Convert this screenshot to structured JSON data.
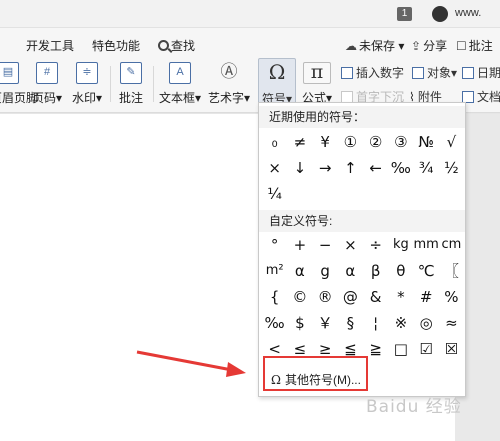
{
  "topbar": {
    "badge": "1",
    "username": "www."
  },
  "tabs": {
    "dev_tools": "开发工具",
    "special": "特色功能",
    "search": "查找"
  },
  "tools": {
    "unsaved": "未保存",
    "share": "分享",
    "comment": "批注"
  },
  "ribbon": {
    "header_footer": "页眉页脚",
    "page_number": "页码",
    "watermark": "水印",
    "comment": "批注",
    "textbox": "文本框",
    "wordart": "艺术字",
    "symbol": "符号",
    "formula": "公式",
    "insert_number": "插入数字",
    "object": "对象",
    "date": "日期",
    "drop_cap": "首字下沉",
    "attachment": "附件",
    "document": "文档"
  },
  "symbol_menu": {
    "recent_title": "近期使用的符号：",
    "recent": [
      "₀",
      "≠",
      "¥",
      "①",
      "②",
      "③",
      "№",
      "√",
      "×",
      "↓",
      "→",
      "↑",
      "←",
      "‰",
      "¾",
      "½",
      "¼"
    ],
    "custom_title": "自定义符号:",
    "custom": [
      "°",
      "+",
      "−",
      "×",
      "÷",
      "kg",
      "mm",
      "cm",
      "m²",
      "α",
      "g",
      "α",
      "β",
      "θ",
      "℃",
      "〖",
      "{",
      "©",
      "®",
      "@",
      "&",
      "*",
      "#",
      "%",
      "‰",
      "$",
      "￥",
      "§",
      "¦",
      "※",
      "◎",
      "≈",
      "<",
      "≤",
      "≥",
      "≦",
      "≧",
      "□",
      "☑",
      "☒"
    ],
    "more_symbols": "其他符号(M)..."
  },
  "watermark_text": "Baidu 经验",
  "colors": {
    "highlight": "#e53935",
    "accent": "#4a6fa5"
  }
}
